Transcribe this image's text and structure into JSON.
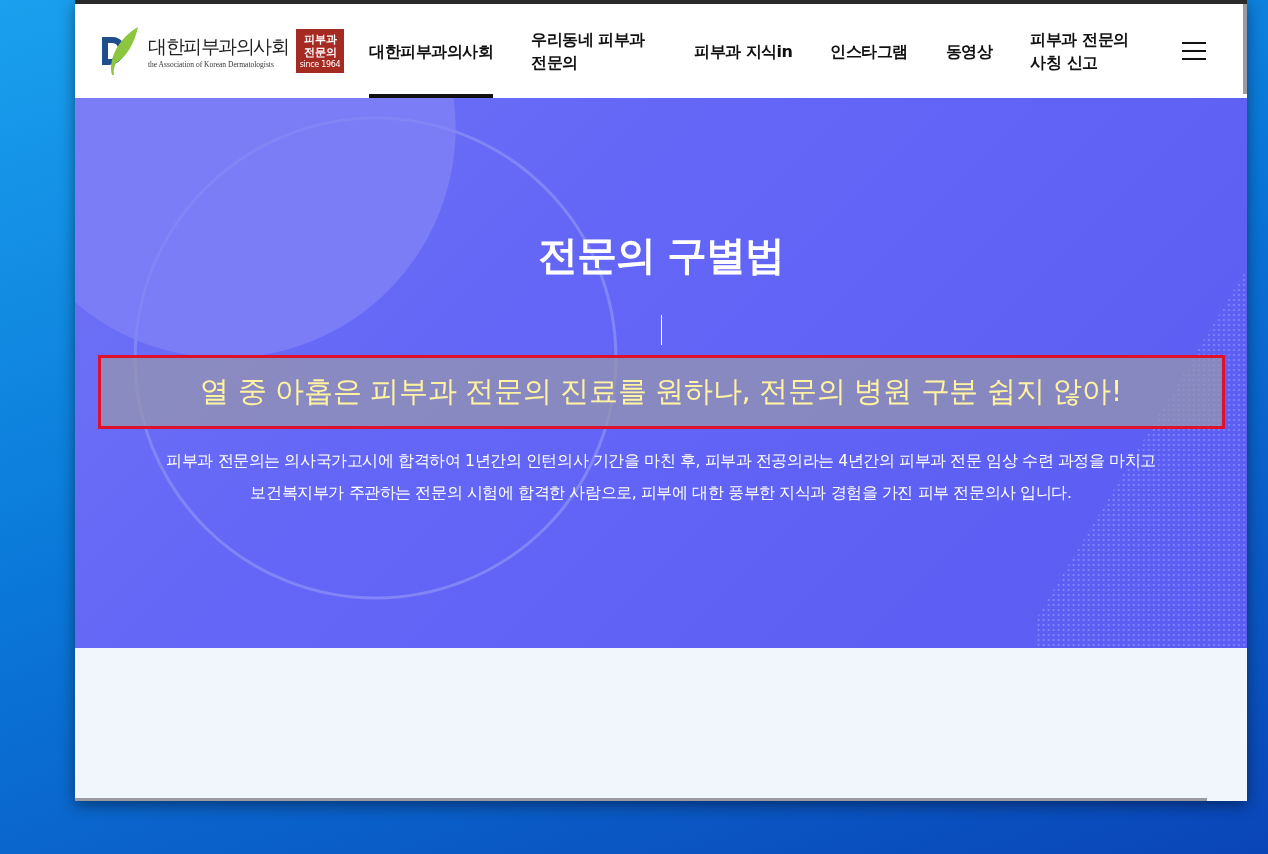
{
  "logo": {
    "name": "대한피부과의사회",
    "subtitle": "the Association of Korean Dermatologists",
    "badge": "피부과 전문의",
    "badge_since": "since 1964"
  },
  "nav": [
    {
      "label": "대한피부과의사회",
      "selected": true
    },
    {
      "label": "우리동네 피부과 전문의",
      "selected": false
    },
    {
      "label": "피부과 지식in",
      "selected": false
    },
    {
      "label": "인스타그램",
      "selected": false
    },
    {
      "label": "동영상",
      "selected": false
    },
    {
      "label": "피부과 전문의 사칭 신고",
      "selected": false
    }
  ],
  "hero": {
    "title": "전문의 구별법",
    "subtitle": "열 중 아홉은 피부과 전문의 진료를 원하나, 전문의 병원 구분 쉽지 않아!",
    "subtitle_highlighted": true,
    "description": "피부과 전문의는 의사국가고시에 합격하여 1년간의 인턴의사 기간을 마친 후, 피부과 전공의라는 4년간의 피부과 전문 임상 수련 과정을 마치고 보건복지부가 주관하는 전문의 시험에 합격한 사람으로, 피부에 대한 풍부한 지식과 경험을 가진 피부 전문의사 입니다."
  }
}
